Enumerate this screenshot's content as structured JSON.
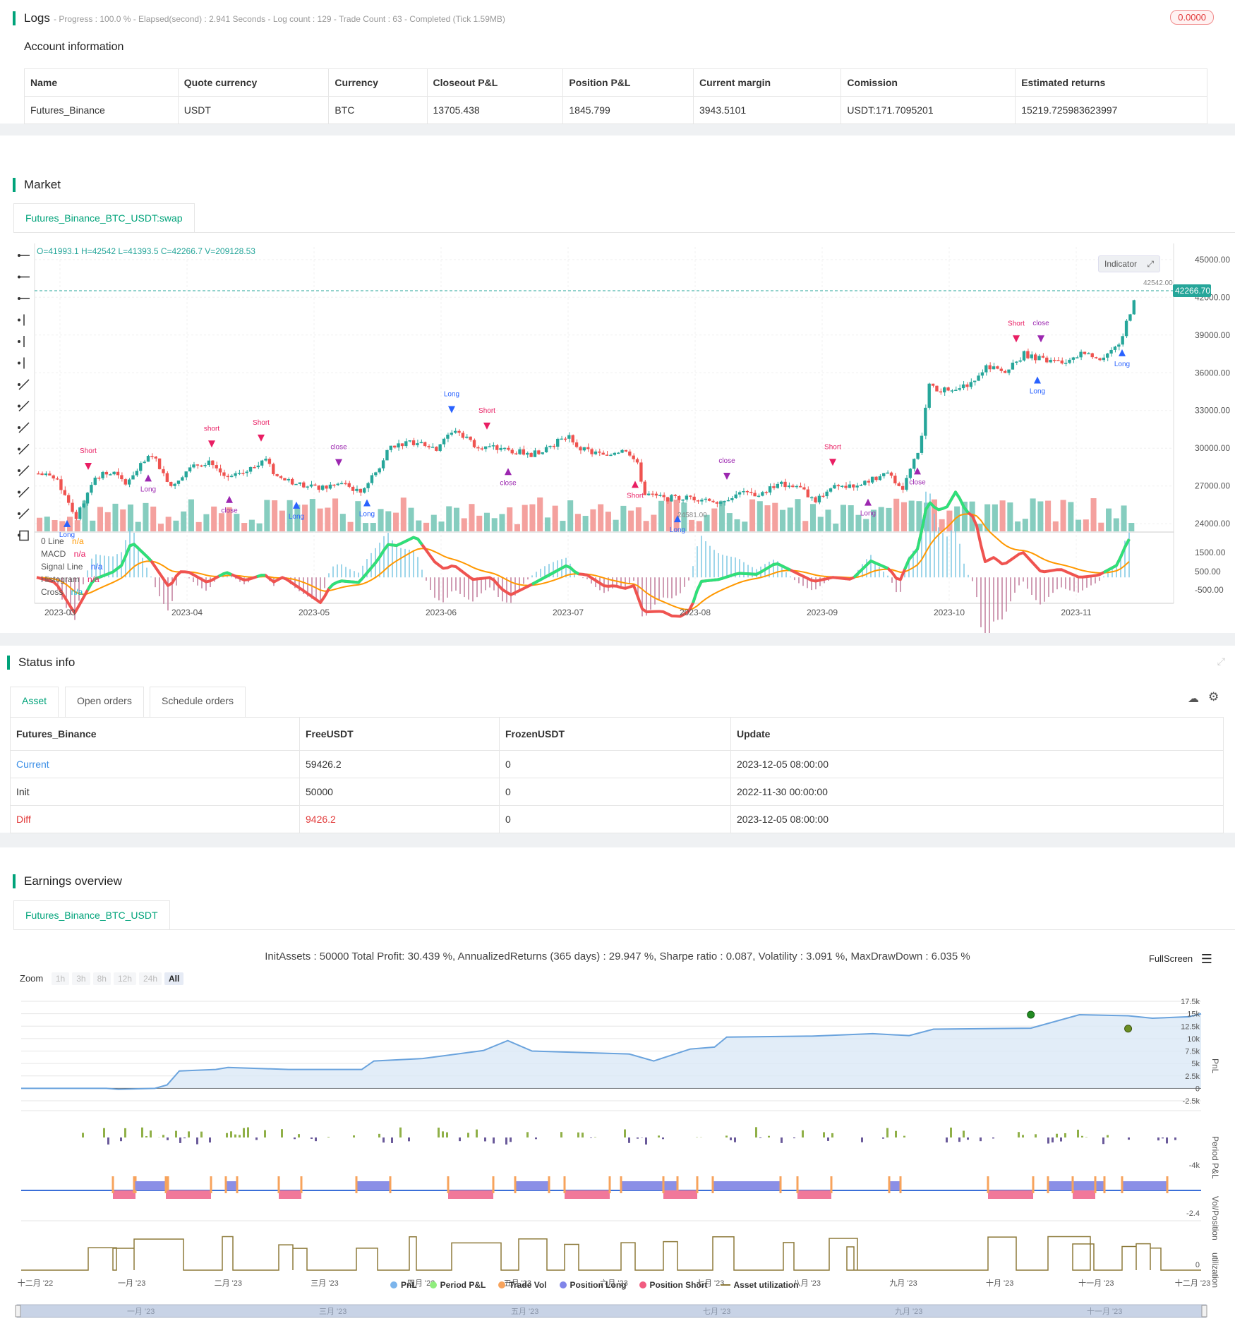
{
  "logs": {
    "title": "Logs",
    "status": "- Progress : 100.0 % - Elapsed(second) : 2.941 Seconds - Log count : 129 - Trade Count : 63 - Completed (Tick 1.59MB)",
    "badge": "0.0000"
  },
  "account": {
    "title": "Account information",
    "headers": [
      "Name",
      "Quote currency",
      "Currency",
      "Closeout P&L",
      "Position P&L",
      "Current margin",
      "Comission",
      "Estimated returns"
    ],
    "row": [
      "Futures_Binance",
      "USDT",
      "BTC",
      "13705.438",
      "1845.799",
      "3943.5101",
      "USDT:171.7095201",
      "15219.725983623997"
    ]
  },
  "market": {
    "title": "Market",
    "tab": "Futures_Binance_BTC_USDT:swap",
    "ohlc": "O=41993.1 H=42542 L=41393.5 C=42266.7 V=209128.53",
    "indicator_btn": "Indicator",
    "price_label": "42266.70",
    "high_label": "42542.00",
    "low_label": "24581.00",
    "y_ticks": [
      "45000.00",
      "42000.00",
      "39000.00",
      "36000.00",
      "33000.00",
      "30000.00",
      "27000.00",
      "24000.00"
    ],
    "macd_ticks": [
      "1500.00",
      "500.00",
      "-500.00"
    ],
    "x_ticks": [
      "2023-03",
      "2023-04",
      "2023-05",
      "2023-06",
      "2023-07",
      "2023-08",
      "2023-09",
      "2023-10",
      "2023-11"
    ],
    "legend": [
      {
        "name": "0 Line",
        "val": "n/a",
        "color": "#ff9800"
      },
      {
        "name": "MACD",
        "val": "n/a",
        "color": "#555"
      },
      {
        "name": "Signal Line",
        "val": "n/a",
        "color": "#2962ff"
      },
      {
        "name": "Histogram",
        "val": "n/a",
        "color": "#e91e63"
      },
      {
        "name": "Cross",
        "val": "n/a",
        "color": "#00bcd4"
      }
    ]
  },
  "status": {
    "title": "Status info",
    "tabs": [
      "Asset",
      "Open orders",
      "Schedule orders"
    ],
    "headers": [
      "Futures_Binance",
      "FreeUSDT",
      "FrozenUSDT",
      "Update"
    ],
    "rows": [
      [
        "Current",
        "59426.2",
        "0",
        "2023-12-05 08:00:00"
      ],
      [
        "Init",
        "50000",
        "0",
        "2022-11-30 00:00:00"
      ],
      [
        "Diff",
        "9426.2",
        "0",
        "2023-12-05 08:00:00"
      ]
    ]
  },
  "earnings": {
    "title": "Earnings overview",
    "tab": "Futures_Binance_BTC_USDT",
    "summary": "InitAssets : 50000 Total Profit: 30.439 %, AnnualizedReturns (365 days) : 29.947 %, Sharpe ratio : 0.087, Volatility : 3.091 %, MaxDrawDown : 6.035 %",
    "fullscreen": "FullScreen",
    "zoom_label": "Zoom",
    "zoom": [
      "1h",
      "3h",
      "8h",
      "12h",
      "24h",
      "All"
    ],
    "pnl_ticks": [
      "17.5k",
      "15k",
      "12.5k",
      "10k",
      "7.5k",
      "5k",
      "2.5k",
      "0",
      "-2.5k"
    ],
    "ppl_tick": "-4k",
    "vol_tick": "-2.4",
    "util_tick": "0",
    "axis_titles": [
      "PnL",
      "Period P&L",
      "Vol/Position",
      "utilization"
    ],
    "x_ticks": [
      "十二月 '22",
      "一月 '23",
      "二月 '23",
      "三月 '23",
      "四月 '23",
      "五月 '23",
      "六月 '23",
      "七月 '23",
      "八月 '23",
      "九月 '23",
      "十月 '23",
      "十一月 '23",
      "十二月 '23"
    ],
    "nav_ticks": [
      "一月 '23",
      "三月 '23",
      "五月 '23",
      "七月 '23",
      "九月 '23",
      "十一月 '23"
    ],
    "legend": [
      {
        "name": "PnL",
        "color": "#7cb5ec"
      },
      {
        "name": "Period P&L",
        "color": "#90ed7d"
      },
      {
        "name": "Trade Vol",
        "color": "#f7a35c"
      },
      {
        "name": "Position Long",
        "color": "#8085e9"
      },
      {
        "name": "Position Short",
        "color": "#f15c80"
      },
      {
        "name": "Asset utilization",
        "color": "#8d7a3a"
      }
    ]
  },
  "chart_data": [
    {
      "type": "candlestick",
      "title": "",
      "x_range": [
        "2023-02-22",
        "2023-11-15"
      ],
      "ylim": [
        23000,
        46000
      ],
      "close_path": [
        [
          0,
          28000
        ],
        [
          10,
          27500
        ],
        [
          20,
          24500
        ],
        [
          30,
          27800
        ],
        [
          40,
          28000
        ],
        [
          45,
          27200
        ],
        [
          60,
          29500
        ],
        [
          70,
          27000
        ],
        [
          80,
          28500
        ],
        [
          90,
          29000
        ],
        [
          100,
          27500
        ],
        [
          110,
          28200
        ],
        [
          120,
          29300
        ],
        [
          125,
          27800
        ],
        [
          140,
          27000
        ],
        [
          150,
          26800
        ],
        [
          160,
          27200
        ],
        [
          170,
          26500
        ],
        [
          180,
          28500
        ],
        [
          185,
          30200
        ],
        [
          200,
          30500
        ],
        [
          210,
          30000
        ],
        [
          215,
          31000
        ],
        [
          220,
          31500
        ],
        [
          230,
          30300
        ],
        [
          240,
          30000
        ],
        [
          250,
          29800
        ],
        [
          260,
          29500
        ],
        [
          270,
          30200
        ],
        [
          280,
          31000
        ],
        [
          285,
          30000
        ],
        [
          300,
          29300
        ],
        [
          305,
          29800
        ],
        [
          310,
          29900
        ],
        [
          315,
          29200
        ],
        [
          320,
          26400
        ],
        [
          330,
          26000
        ],
        [
          340,
          26100
        ],
        [
          350,
          26000
        ],
        [
          360,
          25800
        ],
        [
          370,
          26500
        ],
        [
          380,
          26300
        ],
        [
          390,
          27200
        ],
        [
          400,
          27000
        ],
        [
          410,
          25900
        ],
        [
          420,
          27200
        ],
        [
          430,
          26800
        ],
        [
          440,
          27500
        ],
        [
          450,
          28000
        ],
        [
          455,
          26500
        ],
        [
          460,
          28500
        ],
        [
          465,
          30000
        ],
        [
          470,
          35000
        ],
        [
          475,
          34300
        ],
        [
          480,
          34800
        ],
        [
          490,
          35000
        ],
        [
          500,
          36500
        ],
        [
          510,
          36000
        ],
        [
          520,
          37500
        ],
        [
          530,
          37000
        ],
        [
          540,
          36800
        ],
        [
          550,
          37500
        ],
        [
          560,
          37200
        ],
        [
          570,
          38000
        ],
        [
          575,
          40500
        ],
        [
          580,
          42300
        ]
      ]
    },
    {
      "type": "line",
      "title": "MACD",
      "series": [
        {
          "name": "MACD"
        },
        {
          "name": "Signal Line"
        }
      ],
      "ylim": [
        -1200,
        2200
      ]
    },
    {
      "type": "area",
      "title": "PnL",
      "ylim": [
        -2500,
        17500
      ],
      "x": [
        "2022-12",
        "2023-01",
        "2023-02",
        "2023-03",
        "2023-04",
        "2023-05",
        "2023-06",
        "2023-07",
        "2023-08",
        "2023-09",
        "2023-10",
        "2023-11",
        "2023-12"
      ],
      "path": [
        [
          0,
          0
        ],
        [
          7,
          0
        ],
        [
          8,
          -200
        ],
        [
          11,
          0
        ],
        [
          12,
          700
        ],
        [
          13,
          3500
        ],
        [
          16,
          3800
        ],
        [
          17,
          4200
        ],
        [
          22,
          3800
        ],
        [
          28,
          3800
        ],
        [
          29,
          5500
        ],
        [
          33,
          6000
        ],
        [
          38,
          7600
        ],
        [
          40,
          9600
        ],
        [
          42,
          7500
        ],
        [
          50,
          6900
        ],
        [
          52,
          5500
        ],
        [
          55,
          7900
        ],
        [
          57,
          8300
        ],
        [
          58,
          10300
        ],
        [
          65,
          10500
        ],
        [
          70,
          11000
        ],
        [
          73,
          10600
        ],
        [
          75,
          11900
        ],
        [
          83,
          12100
        ],
        [
          87,
          14800
        ],
        [
          91,
          14600
        ],
        [
          93,
          14100
        ],
        [
          96,
          14400
        ],
        [
          97,
          15000
        ]
      ]
    }
  ]
}
